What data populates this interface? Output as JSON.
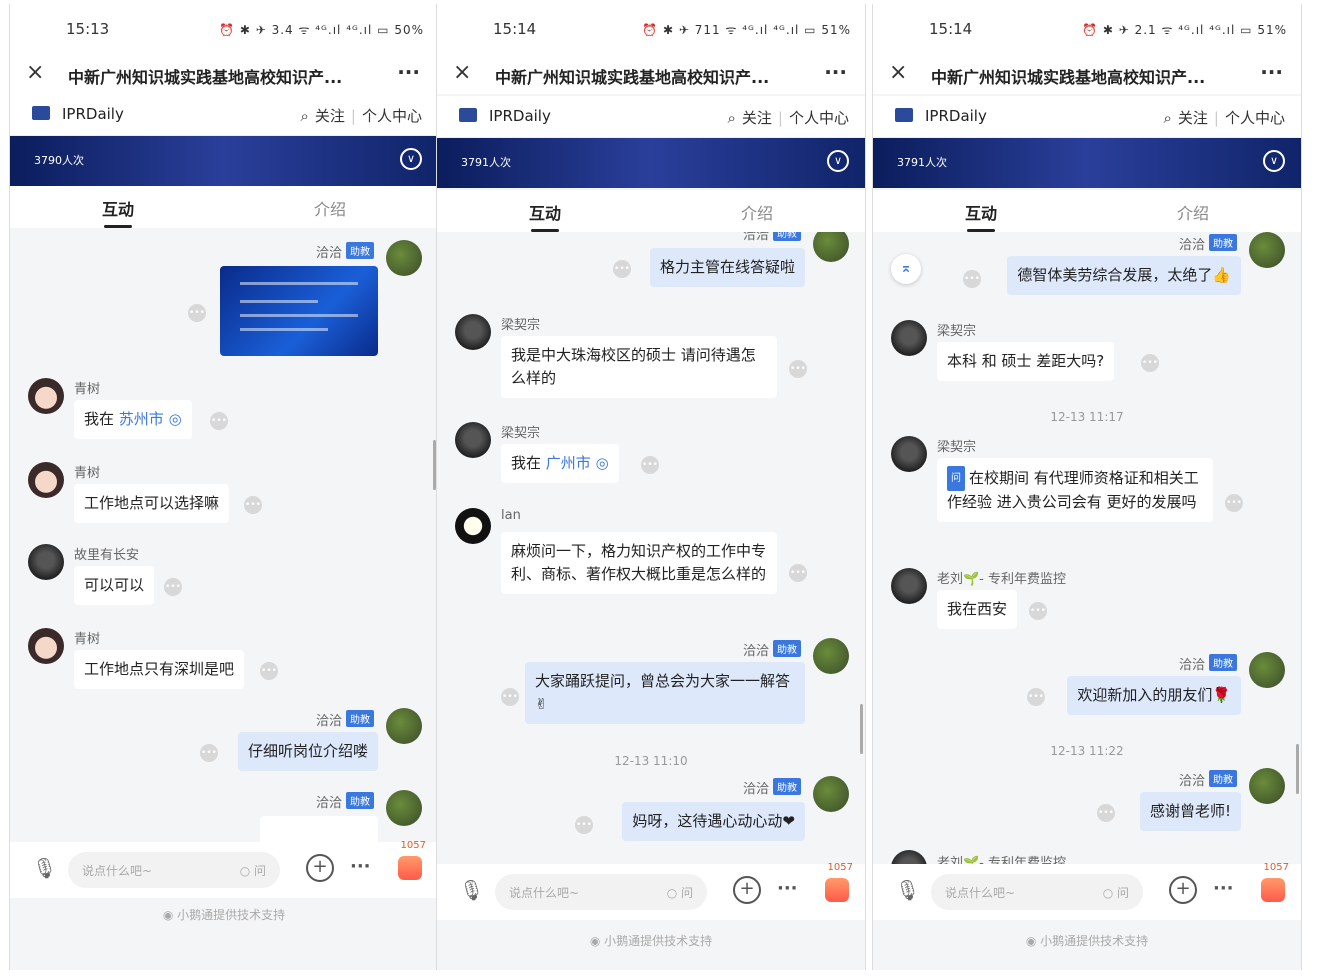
{
  "phones": [
    {
      "status": {
        "time": "15:13",
        "icons": "⏰ ✱ ✈ 3.4 ᯤ ⁴ᴳ.ıl ⁴ᴳ.ıl ▭ 50%"
      },
      "topbar": {
        "close": "×",
        "title": "中新广州知识城实践基地高校知识产...",
        "more": "···"
      },
      "brand": {
        "name": "IPRDaily",
        "follow": "关注",
        "center": "个人中心",
        "search_icon": "⌕"
      },
      "banner": {
        "views": "3790人次"
      },
      "tabs": {
        "t1": "互动",
        "t2": "介绍"
      },
      "messages": [
        {
          "name": "洽洽",
          "badge": "助教"
        },
        {
          "name": "青树",
          "prefix": "我在",
          "loc": "苏州市",
          "pin": "◎"
        },
        {
          "name": "青树",
          "text": "工作地点可以选择嘛"
        },
        {
          "name": "故里有长安",
          "text": "可以可以"
        },
        {
          "name": "青树",
          "text": "工作地点只有深圳是吧"
        },
        {
          "name": "洽洽",
          "badge": "助教",
          "text": "仔细听岗位介绍喽"
        },
        {
          "name": "洽洽",
          "badge": "助教"
        }
      ],
      "bottom": {
        "placeholder": "说点什么吧~",
        "ask": "○ 问",
        "likes": "1057"
      },
      "footer": "◉ 小鹅通提供技术支持"
    },
    {
      "status": {
        "time": "15:14",
        "icons": "⏰ ✱ ✈ 711 ᯤ ⁴ᴳ.ıl ⁴ᴳ.ıl ▭ 51%"
      },
      "topbar": {
        "close": "×",
        "title": "中新广州知识城实践基地高校知识产...",
        "more": "···"
      },
      "brand": {
        "name": "IPRDaily",
        "follow": "关注",
        "center": "个人中心",
        "search_icon": "⌕"
      },
      "banner": {
        "views": "3791人次"
      },
      "tabs": {
        "t1": "互动",
        "t2": "介绍"
      },
      "messages": [
        {
          "name": "洽洽",
          "badge": "助教",
          "text": "格力主管在线答疑啦"
        },
        {
          "name": "梁契宗",
          "text": "我是中大珠海校区的硕士 请问待遇怎么样的"
        },
        {
          "name": "梁契宗",
          "prefix": "我在",
          "loc": "广州市",
          "pin": "◎"
        },
        {
          "name": "lan",
          "text": "麻烦问一下，格力知识产权的工作中专利、商标、著作权大概比重是怎么样的"
        },
        {
          "name": "洽洽",
          "badge": "助教",
          "text": "大家踊跃提问，曾总会为大家一一解答✌"
        },
        {
          "ts": "12-13 11:10"
        },
        {
          "name": "洽洽",
          "badge": "助教",
          "text": "妈呀，这待遇心动心动❤"
        }
      ],
      "bottom": {
        "placeholder": "说点什么吧~",
        "ask": "○ 问",
        "likes": "1057"
      },
      "footer": "◉ 小鹅通提供技术支持"
    },
    {
      "status": {
        "time": "15:14",
        "icons": "⏰ ✱ ✈ 2.1 ᯤ ⁴ᴳ.ıl ⁴ᴳ.ıl ▭ 51%"
      },
      "topbar": {
        "close": "×",
        "title": "中新广州知识城实践基地高校知识产...",
        "more": "···"
      },
      "brand": {
        "name": "IPRDaily",
        "follow": "关注",
        "center": "个人中心",
        "search_icon": "⌕"
      },
      "banner": {
        "views": "3791人次"
      },
      "tabs": {
        "t1": "互动",
        "t2": "介绍"
      },
      "messages": [
        {
          "name": "洽洽",
          "badge": "助教",
          "text": "德智体美劳综合发展，太绝了👍"
        },
        {
          "name": "梁契宗",
          "text": "本科 和 硕士 差距大吗?"
        },
        {
          "ts": "12-13 11:17"
        },
        {
          "name": "梁契宗",
          "qtag": "问",
          "text": "在校期间 有代理师资格证和相关工作经验 进入贵公司会有 更好的发展吗"
        },
        {
          "name": "老刘🌱- 专利年费监控",
          "text": "我在西安"
        },
        {
          "name": "洽洽",
          "badge": "助教",
          "text": "欢迎新加入的朋友们🌹"
        },
        {
          "ts": "12-13 11:22"
        },
        {
          "name": "洽洽",
          "badge": "助教",
          "text": "感谢曾老师!"
        },
        {
          "name": "老刘🌱- 专利年费监控"
        }
      ],
      "bottom": {
        "placeholder": "说点什么吧~",
        "ask": "○ 问",
        "likes": "1057"
      },
      "footer": "◉ 小鹅通提供技术支持"
    }
  ]
}
